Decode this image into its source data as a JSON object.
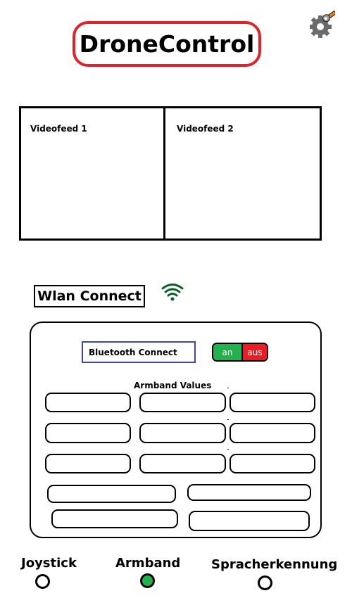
{
  "app": {
    "title": "DroneControl"
  },
  "header": {
    "settings_icon": "gear-wrench-icon"
  },
  "video": {
    "feed1_label": "Videofeed 1",
    "feed2_label": "Videofeed 2"
  },
  "wlan": {
    "label": "Wlan Connect",
    "icon": "wifi-icon"
  },
  "armband": {
    "bluetooth_label": "Bluetooth Connect",
    "toggle_on": "an",
    "toggle_off": "aus",
    "values_label": "Armband Values",
    "colors": {
      "border": "#3c45b5",
      "on": "#22b14c",
      "off": "#ed1c24"
    }
  },
  "modes": {
    "items": [
      {
        "label": "Joystick",
        "selected": false
      },
      {
        "label": "Armband",
        "selected": true
      },
      {
        "label": "Spracherkennung",
        "selected": false
      }
    ]
  },
  "colors": {
    "title_border": "#e0232a",
    "accent_green": "#22b14c"
  }
}
